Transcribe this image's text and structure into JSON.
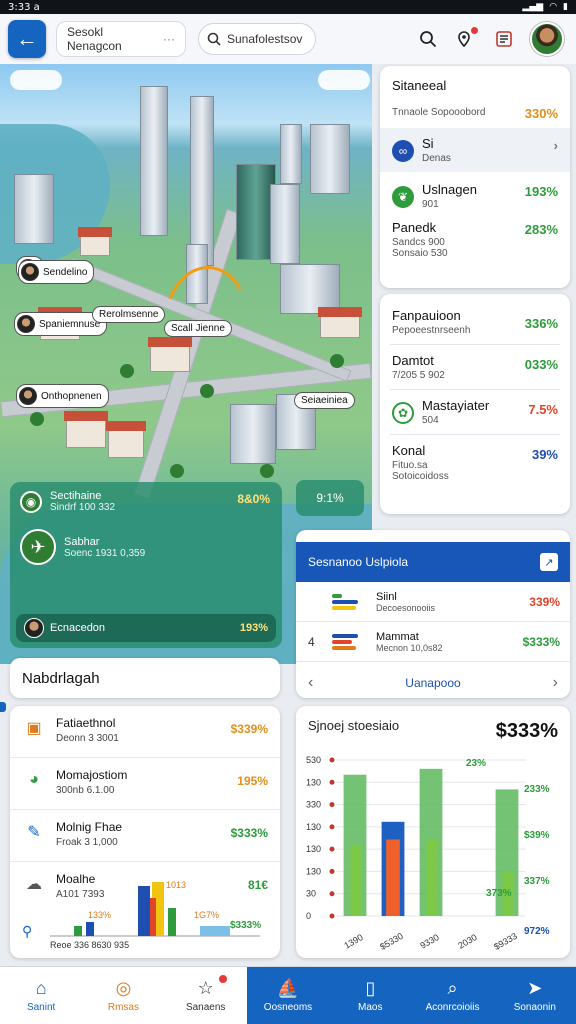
{
  "status_bar": {
    "time": "3:33 a"
  },
  "header": {
    "back_icon": "arrow-left-icon",
    "tab_label": "Sesokl Nenagcon",
    "tab_more": "···",
    "search_text": "Sunafolestsov",
    "icons": [
      "search-icon",
      "location-share-icon",
      "document-icon"
    ]
  },
  "map": {
    "labels": [
      "Sendelino",
      "Spaniemnuse",
      "Rerolmsenne",
      "Scall Jienne",
      "Onthopnenen",
      "Seiaeiniea"
    ],
    "chip_pct": "9:1%"
  },
  "route_card": {
    "row1_title": "Sectihaine",
    "row1_sub": "Sindrf 100 332",
    "row1_pct": "8&0%",
    "row2_title": "Sabhar",
    "row2_sub": "Soenc 1931 0,359",
    "bottom_label": "Ecnacedon",
    "bottom_pct": "193%"
  },
  "stats_panel_1": {
    "title": "Sitaneeal",
    "title_sub": "Tnnaole Sopooobord",
    "title_value": "330%",
    "rows": [
      {
        "title": "Si",
        "sub": "Denas",
        "value": ""
      },
      {
        "title": "Uslnagen",
        "sub": "901",
        "value": "193%"
      },
      {
        "title": "Panedk",
        "sub": "Sandcs 900 Sonsaio 530",
        "value": "283%"
      }
    ]
  },
  "stats_panel_2": {
    "rows": [
      {
        "title": "Fanpauioon",
        "sub": "Pepoeestnrseenh",
        "value": "336%"
      },
      {
        "title": "Damtot",
        "sub": "7/205 5 902",
        "value": "033%"
      },
      {
        "title": "Mastayiater",
        "sub": "504",
        "value": "7.5%"
      },
      {
        "title": "Konal",
        "sub": "Fituo.sa Sotoicoidoss",
        "value": "39%"
      }
    ]
  },
  "score_card": {
    "header": "Sesnanoo Uslpiola",
    "rows": [
      {
        "num": "",
        "title": "Siinl",
        "sub": "Decoesonooiis",
        "value": "339%"
      },
      {
        "num": "4",
        "title": "Mammat",
        "sub": "Mecnon 10,0s82",
        "value": "$333%"
      }
    ],
    "nav_label": "Uanapooo"
  },
  "list": {
    "title": "Nabdrlagah",
    "items": [
      {
        "icon": "store-icon",
        "title": "Fatiaethnol",
        "sub": "Deonn 3 3001",
        "value": "$339%"
      },
      {
        "icon": "chart-pie-icon",
        "title": "Momajostiom",
        "sub": "300nb 6.1.00",
        "value": "195%"
      },
      {
        "icon": "edit-icon",
        "title": "Molnig Fhae",
        "sub": "Froak 3 1,000",
        "value": "$333%"
      },
      {
        "icon": "cloud-icon",
        "title": "Moalhe",
        "sub": "A101 7393",
        "value": "81€"
      }
    ],
    "chart_labels": [
      "133%",
      "1G7%",
      "$333%",
      "1013"
    ],
    "footer": "Reoe 336 8630 935"
  },
  "bar_chart": {
    "title": "Sjnoej stoesiaio",
    "big_value": "$333%",
    "y_ticks": [
      "530",
      "130",
      "330",
      "130",
      "130",
      "130",
      "30",
      "0"
    ],
    "x_ticks": [
      "1390",
      "$5330",
      "9330",
      "2030",
      "$9333"
    ],
    "side_values": [
      "23%",
      "233%",
      "$39%",
      "337%",
      "373%",
      "972%"
    ]
  },
  "chart_data": {
    "type": "bar",
    "title": "Sjnoej stoesiaio",
    "categories": [
      "1390",
      "$5330",
      "9330",
      "2030",
      "$9333"
    ],
    "series": [
      {
        "name": "green",
        "values": [
          480,
          0,
          500,
          0,
          430
        ]
      },
      {
        "name": "blue",
        "values": [
          0,
          320,
          0,
          0,
          0
        ]
      },
      {
        "name": "orange",
        "values": [
          0,
          260,
          0,
          0,
          0
        ]
      },
      {
        "name": "lime",
        "values": [
          240,
          0,
          260,
          0,
          150
        ]
      }
    ],
    "ylim": [
      0,
      530
    ]
  },
  "bottom_nav": {
    "items": [
      {
        "icon": "home-icon",
        "label": "Sanint"
      },
      {
        "icon": "compass-icon",
        "label": "Rmsas"
      },
      {
        "icon": "star-icon",
        "label": "Sanaens"
      },
      {
        "icon": "sailboat-icon",
        "label": "Oosneoms"
      },
      {
        "icon": "phone-icon",
        "label": "Maos"
      },
      {
        "icon": "search-icon",
        "label": "Aconrcoioiis"
      },
      {
        "icon": "paper-plane-icon",
        "label": "Sonaonin"
      }
    ]
  },
  "colors": {
    "primary": "#1565c0",
    "green": "#2e9b3c",
    "orange": "#e0901b",
    "red": "#e0452a"
  }
}
